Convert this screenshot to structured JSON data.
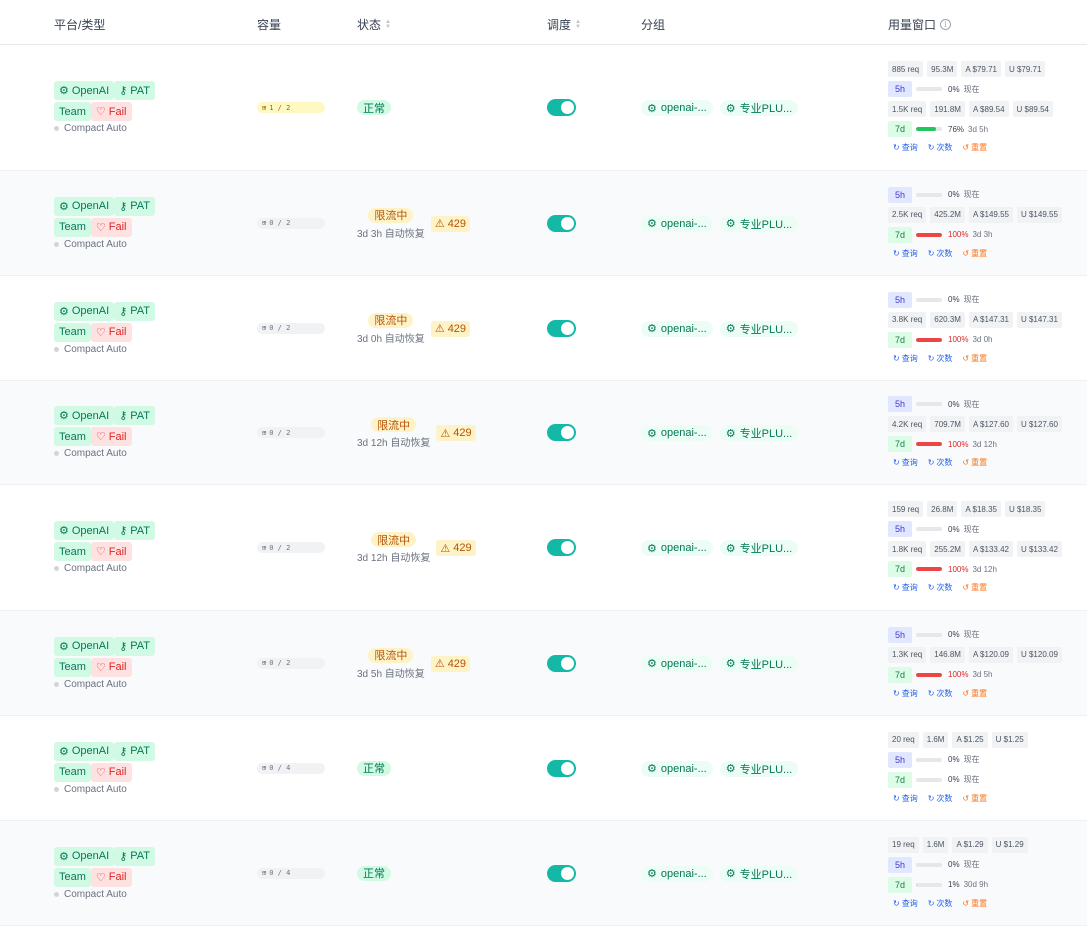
{
  "headers": {
    "platform": "平台/类型",
    "capacity": "容量",
    "status": "状态",
    "schedule": "调度",
    "group": "分组",
    "usage": "用量窗口"
  },
  "colors": {
    "accent": "#14b8a6",
    "green_bar": "#22c55e",
    "red_bar": "#ef4444",
    "light_bar": "#d1d5db"
  },
  "rows": [
    {
      "platform": "OpenAI",
      "auth": "PAT",
      "plan": "Team",
      "health": "Fail",
      "mode": "Compact Auto",
      "capacity": "1 / 2",
      "capacity_highlight": true,
      "status": "正常",
      "limited": false,
      "recover": "",
      "code": "",
      "groups": [
        "openai-...",
        "专业PLU..."
      ],
      "usage_lines": [
        {
          "type": "stats",
          "values": [
            "885 req",
            "95.3M",
            "A $79.71",
            "U $79.71"
          ]
        },
        {
          "type": "window",
          "label": "5h",
          "pct": "0%",
          "fill": 0,
          "bar": "gray",
          "time": "现在"
        },
        {
          "type": "stats",
          "values": [
            "1.5K req",
            "191.8M",
            "A $89.54",
            "U $89.54"
          ]
        },
        {
          "type": "window",
          "label": "7d",
          "pct": "76%",
          "fill": 0.76,
          "bar": "green",
          "time": "3d 5h"
        }
      ]
    },
    {
      "platform": "OpenAI",
      "auth": "PAT",
      "plan": "Team",
      "health": "Fail",
      "mode": "Compact Auto",
      "capacity": "0 / 2",
      "capacity_highlight": false,
      "status": "限流中",
      "limited": true,
      "recover": "3d 3h 自动恢复",
      "code": "429",
      "groups": [
        "openai-...",
        "专业PLU..."
      ],
      "usage_lines": [
        {
          "type": "window",
          "label": "5h",
          "pct": "0%",
          "fill": 0,
          "bar": "gray",
          "time": "现在"
        },
        {
          "type": "stats",
          "values": [
            "2.5K req",
            "425.2M",
            "A $149.55",
            "U $149.55"
          ]
        },
        {
          "type": "window",
          "label": "7d",
          "pct": "100%",
          "fill": 1,
          "bar": "red",
          "time": "3d 3h"
        }
      ]
    },
    {
      "platform": "OpenAI",
      "auth": "PAT",
      "plan": "Team",
      "health": "Fail",
      "mode": "Compact Auto",
      "capacity": "0 / 2",
      "capacity_highlight": false,
      "status": "限流中",
      "limited": true,
      "recover": "3d 0h 自动恢复",
      "code": "429",
      "groups": [
        "openai-...",
        "专业PLU..."
      ],
      "usage_lines": [
        {
          "type": "window",
          "label": "5h",
          "pct": "0%",
          "fill": 0,
          "bar": "gray",
          "time": "现在"
        },
        {
          "type": "stats",
          "values": [
            "3.8K req",
            "620.3M",
            "A $147.31",
            "U $147.31"
          ]
        },
        {
          "type": "window",
          "label": "7d",
          "pct": "100%",
          "fill": 1,
          "bar": "red",
          "time": "3d 0h"
        }
      ]
    },
    {
      "platform": "OpenAI",
      "auth": "PAT",
      "plan": "Team",
      "health": "Fail",
      "mode": "Compact Auto",
      "capacity": "0 / 2",
      "capacity_highlight": false,
      "status": "限流中",
      "limited": true,
      "recover": "3d 12h 自动恢复",
      "code": "429",
      "groups": [
        "openai-...",
        "专业PLU..."
      ],
      "usage_lines": [
        {
          "type": "window",
          "label": "5h",
          "pct": "0%",
          "fill": 0,
          "bar": "gray",
          "time": "现在"
        },
        {
          "type": "stats",
          "values": [
            "4.2K req",
            "709.7M",
            "A $127.60",
            "U $127.60"
          ]
        },
        {
          "type": "window",
          "label": "7d",
          "pct": "100%",
          "fill": 1,
          "bar": "red",
          "time": "3d 12h"
        }
      ]
    },
    {
      "platform": "OpenAI",
      "auth": "PAT",
      "plan": "Team",
      "health": "Fail",
      "mode": "Compact Auto",
      "capacity": "0 / 2",
      "capacity_highlight": false,
      "status": "限流中",
      "limited": true,
      "recover": "3d 12h 自动恢复",
      "code": "429",
      "groups": [
        "openai-...",
        "专业PLU..."
      ],
      "usage_lines": [
        {
          "type": "stats",
          "values": [
            "159 req",
            "26.8M",
            "A $18.35",
            "U $18.35"
          ]
        },
        {
          "type": "window",
          "label": "5h",
          "pct": "0%",
          "fill": 0,
          "bar": "gray",
          "time": "现在"
        },
        {
          "type": "stats",
          "values": [
            "1.8K req",
            "255.2M",
            "A $133.42",
            "U $133.42"
          ]
        },
        {
          "type": "window",
          "label": "7d",
          "pct": "100%",
          "fill": 1,
          "bar": "red",
          "time": "3d 12h"
        }
      ]
    },
    {
      "platform": "OpenAI",
      "auth": "PAT",
      "plan": "Team",
      "health": "Fail",
      "mode": "Compact Auto",
      "capacity": "0 / 2",
      "capacity_highlight": false,
      "status": "限流中",
      "limited": true,
      "recover": "3d 5h 自动恢复",
      "code": "429",
      "groups": [
        "openai-...",
        "专业PLU..."
      ],
      "usage_lines": [
        {
          "type": "window",
          "label": "5h",
          "pct": "0%",
          "fill": 0,
          "bar": "gray",
          "time": "现在"
        },
        {
          "type": "stats",
          "values": [
            "1.3K req",
            "146.8M",
            "A $120.09",
            "U $120.09"
          ]
        },
        {
          "type": "window",
          "label": "7d",
          "pct": "100%",
          "fill": 1,
          "bar": "red",
          "time": "3d 5h"
        }
      ]
    },
    {
      "platform": "OpenAI",
      "auth": "PAT",
      "plan": "Team",
      "health": "Fail",
      "mode": "Compact Auto",
      "capacity": "0 / 4",
      "capacity_highlight": false,
      "status": "正常",
      "limited": false,
      "recover": "",
      "code": "",
      "groups": [
        "openai-...",
        "专业PLU..."
      ],
      "usage_lines": [
        {
          "type": "stats",
          "values": [
            "20 req",
            "1.6M",
            "A $1.25",
            "U $1.25"
          ]
        },
        {
          "type": "window",
          "label": "5h",
          "pct": "0%",
          "fill": 0,
          "bar": "gray",
          "time": "现在"
        },
        {
          "type": "window",
          "label": "7d",
          "pct": "0%",
          "fill": 0,
          "bar": "gray",
          "time": "现在"
        }
      ]
    },
    {
      "platform": "OpenAI",
      "auth": "PAT",
      "plan": "Team",
      "health": "Fail",
      "mode": "Compact Auto",
      "capacity": "0 / 4",
      "capacity_highlight": false,
      "status": "正常",
      "limited": false,
      "recover": "",
      "code": "",
      "groups": [
        "openai-...",
        "专业PLU..."
      ],
      "usage_lines": [
        {
          "type": "stats",
          "values": [
            "19 req",
            "1.6M",
            "A $1.29",
            "U $1.29"
          ]
        },
        {
          "type": "window",
          "label": "5h",
          "pct": "0%",
          "fill": 0,
          "bar": "gray",
          "time": "现在"
        },
        {
          "type": "window",
          "label": "7d",
          "pct": "1%",
          "fill": 0.01,
          "bar": "gray",
          "time": "30d 9h"
        }
      ]
    }
  ],
  "actions": {
    "query": "查询",
    "count": "次数",
    "reset": "重置"
  }
}
